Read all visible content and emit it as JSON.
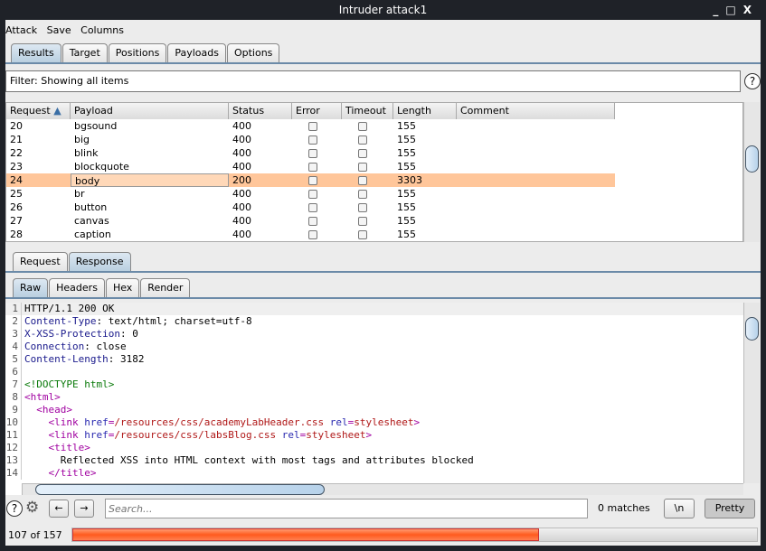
{
  "window": {
    "title": "Intruder attack1",
    "controls": [
      "_",
      "□",
      "X"
    ]
  },
  "menu": [
    "Attack",
    "Save",
    "Columns"
  ],
  "main_tabs": [
    "Results",
    "Target",
    "Positions",
    "Payloads",
    "Options"
  ],
  "filter": "Filter: Showing all items",
  "table": {
    "columns": [
      "Request",
      "Payload",
      "Status",
      "Error",
      "Timeout",
      "Length",
      "Comment"
    ],
    "sort_indicator": "▲",
    "rows": [
      {
        "request": "20",
        "payload": "bgsound",
        "status": "400",
        "length": "155"
      },
      {
        "request": "21",
        "payload": "big",
        "status": "400",
        "length": "155"
      },
      {
        "request": "22",
        "payload": "blink",
        "status": "400",
        "length": "155"
      },
      {
        "request": "23",
        "payload": "blockquote",
        "status": "400",
        "length": "155"
      },
      {
        "request": "24",
        "payload": "body",
        "status": "200",
        "length": "3303",
        "selected": true
      },
      {
        "request": "25",
        "payload": "br",
        "status": "400",
        "length": "155"
      },
      {
        "request": "26",
        "payload": "button",
        "status": "400",
        "length": "155"
      },
      {
        "request": "27",
        "payload": "canvas",
        "status": "400",
        "length": "155"
      },
      {
        "request": "28",
        "payload": "caption",
        "status": "400",
        "length": "155"
      }
    ]
  },
  "msg_tabs": [
    "Request",
    "Response"
  ],
  "view_tabs": [
    "Raw",
    "Headers",
    "Hex",
    "Render"
  ],
  "response_lines": [
    [
      [
        "HTTP/1.1 200 OK",
        ""
      ]
    ],
    [
      [
        "Content-Type",
        "k"
      ],
      [
        ": text/html; charset=utf-8",
        ""
      ]
    ],
    [
      [
        "X-XSS-Protection",
        "k"
      ],
      [
        ": 0",
        ""
      ]
    ],
    [
      [
        "Connection",
        "k"
      ],
      [
        ": close",
        ""
      ]
    ],
    [
      [
        "Content-Length",
        "k"
      ],
      [
        ": 3182",
        ""
      ]
    ],
    [],
    [
      [
        "<!DOCTYPE html>",
        "g"
      ]
    ],
    [
      [
        "<",
        "m"
      ],
      [
        "html",
        "m"
      ],
      [
        ">",
        "m"
      ]
    ],
    [
      [
        "  <head>",
        "m"
      ]
    ],
    [
      [
        "    <link ",
        "m"
      ],
      [
        "href",
        "b"
      ],
      [
        "=",
        "m"
      ],
      [
        "/resources/css/academyLabHeader.css",
        "r"
      ],
      [
        " rel",
        "b"
      ],
      [
        "=",
        "m"
      ],
      [
        "stylesheet",
        "r"
      ],
      [
        ">",
        "m"
      ]
    ],
    [
      [
        "    <link ",
        "m"
      ],
      [
        "href",
        "b"
      ],
      [
        "=",
        "m"
      ],
      [
        "/resources/css/labsBlog.css",
        "r"
      ],
      [
        " rel",
        "b"
      ],
      [
        "=",
        "m"
      ],
      [
        "stylesheet",
        "r"
      ],
      [
        ">",
        "m"
      ]
    ],
    [
      [
        "    <title>",
        "m"
      ]
    ],
    [
      [
        "      Reflected XSS into HTML context with most tags and attributes blocked",
        ""
      ]
    ],
    [
      [
        "    </title>",
        "m"
      ]
    ]
  ],
  "search": {
    "placeholder": "Search...",
    "matches": "0 matches",
    "newline_label": "\\n",
    "pretty_label": "Pretty"
  },
  "progress": {
    "label": "107 of 157",
    "done": 107,
    "total": 157,
    "color": "#ff6a2e"
  }
}
